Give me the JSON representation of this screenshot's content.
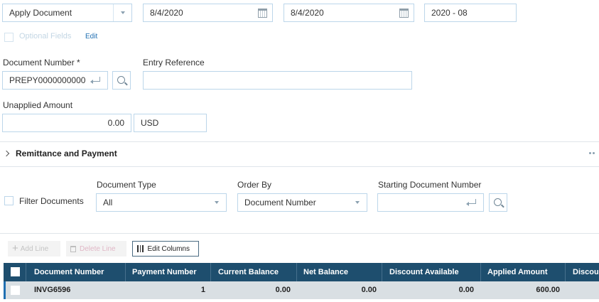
{
  "header": {
    "action_value": "Apply Document",
    "date1": "8/4/2020",
    "date2": "8/4/2020",
    "period": "2020 - 08"
  },
  "optional_fields": {
    "label": "Optional Fields",
    "edit": "Edit"
  },
  "document_number": {
    "label": "Document Number *",
    "value": "PREPY0000000000"
  },
  "entry_reference": {
    "label": "Entry Reference",
    "value": ""
  },
  "unapplied": {
    "label": "Unapplied Amount",
    "amount": "0.00",
    "currency": "USD"
  },
  "remittance": {
    "label": "Remittance and Payment"
  },
  "filter": {
    "filter_label": "Filter Documents",
    "doc_type_label": "Document Type",
    "doc_type_value": "All",
    "order_by_label": "Order By",
    "order_by_value": "Document Number",
    "start_doc_label": "Starting Document Number",
    "start_doc_value": ""
  },
  "toolbar": {
    "add_line": "Add Line",
    "delete_line": "Delete Line",
    "edit_columns": "Edit Columns"
  },
  "grid": {
    "columns": [
      "Document Number",
      "Payment Number",
      "Current Balance",
      "Net Balance",
      "Discount Available",
      "Applied Amount",
      "Discou"
    ],
    "rows": [
      {
        "document_number": "INVG6596",
        "payment_number": "1",
        "current_balance": "0.00",
        "net_balance": "0.00",
        "discount_available": "0.00",
        "applied_amount": "600.00"
      }
    ]
  },
  "colors": {
    "accent": "#1e4e6e",
    "link": "#1f6fb2",
    "field_border": "#bcd6ea",
    "row_bg": "#d9dfe3"
  },
  "icons": [
    "chevron-down-icon",
    "calendar-icon",
    "enter-icon",
    "search-icon",
    "chevron-right-icon",
    "more-icon",
    "plus-icon",
    "trash-icon",
    "columns-icon"
  ]
}
